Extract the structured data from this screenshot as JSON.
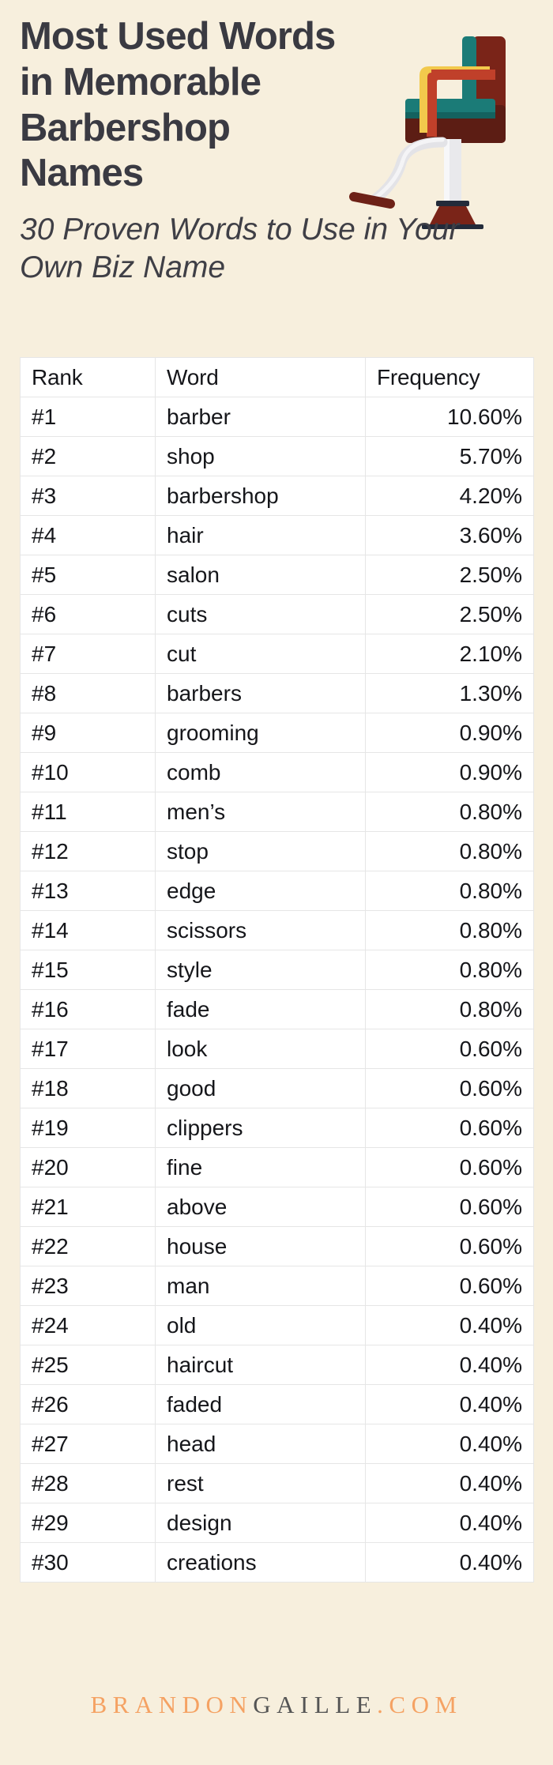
{
  "header": {
    "title": "Most Used Words in Memorable Barbershop Names",
    "title_lines": [
      "Most Used Words",
      "in Memorable",
      "Barbershop",
      "Names"
    ],
    "subtitle": "30 Proven Words to Use in Your Own Biz Name",
    "illustration": "barber-chair-icon"
  },
  "colors": {
    "background": "#f7efdd",
    "title_text": "#3a3a42",
    "table_background": "#ffffff",
    "table_border": "#e6e6e6",
    "table_text": "#15161a",
    "footer_accent": "#f5a263",
    "footer_dark": "#555555",
    "chair_upholstery_teal": "#1b7b77",
    "chair_frame_maroon": "#7a2418",
    "chair_highlight_red": "#c0402a",
    "chair_highlight_yellow": "#f2c94c",
    "chair_post_white": "#e9e9ec",
    "chair_base_dark": "#232b3a"
  },
  "table": {
    "columns": [
      "Rank",
      "Word",
      "Frequency"
    ],
    "rows": [
      {
        "rank": "#1",
        "word": "barber",
        "frequency": "10.60%"
      },
      {
        "rank": "#2",
        "word": "shop",
        "frequency": "5.70%"
      },
      {
        "rank": "#3",
        "word": "barbershop",
        "frequency": "4.20%"
      },
      {
        "rank": "#4",
        "word": "hair",
        "frequency": "3.60%"
      },
      {
        "rank": "#5",
        "word": "salon",
        "frequency": "2.50%"
      },
      {
        "rank": "#6",
        "word": "cuts",
        "frequency": "2.50%"
      },
      {
        "rank": "#7",
        "word": "cut",
        "frequency": "2.10%"
      },
      {
        "rank": "#8",
        "word": "barbers",
        "frequency": "1.30%"
      },
      {
        "rank": "#9",
        "word": "grooming",
        "frequency": "0.90%"
      },
      {
        "rank": "#10",
        "word": "comb",
        "frequency": "0.90%"
      },
      {
        "rank": "#11",
        "word": "men’s",
        "frequency": "0.80%"
      },
      {
        "rank": "#12",
        "word": "stop",
        "frequency": "0.80%"
      },
      {
        "rank": "#13",
        "word": "edge",
        "frequency": "0.80%"
      },
      {
        "rank": "#14",
        "word": "scissors",
        "frequency": "0.80%"
      },
      {
        "rank": "#15",
        "word": "style",
        "frequency": "0.80%"
      },
      {
        "rank": "#16",
        "word": "fade",
        "frequency": "0.80%"
      },
      {
        "rank": "#17",
        "word": "look",
        "frequency": "0.60%"
      },
      {
        "rank": "#18",
        "word": "good",
        "frequency": "0.60%"
      },
      {
        "rank": "#19",
        "word": "clippers",
        "frequency": "0.60%"
      },
      {
        "rank": "#20",
        "word": "fine",
        "frequency": "0.60%"
      },
      {
        "rank": "#21",
        "word": "above",
        "frequency": "0.60%"
      },
      {
        "rank": "#22",
        "word": "house",
        "frequency": "0.60%"
      },
      {
        "rank": "#23",
        "word": "man",
        "frequency": "0.60%"
      },
      {
        "rank": "#24",
        "word": "old",
        "frequency": "0.40%"
      },
      {
        "rank": "#25",
        "word": "haircut",
        "frequency": "0.40%"
      },
      {
        "rank": "#26",
        "word": "faded",
        "frequency": "0.40%"
      },
      {
        "rank": "#27",
        "word": "head",
        "frequency": "0.40%"
      },
      {
        "rank": "#28",
        "word": "rest",
        "frequency": "0.40%"
      },
      {
        "rank": "#29",
        "word": "design",
        "frequency": "0.40%"
      },
      {
        "rank": "#30",
        "word": "creations",
        "frequency": "0.40%"
      }
    ]
  },
  "footer": {
    "brand_accent_1": "BRANDON",
    "brand_dark": "GAILLE",
    "brand_accent_2": ".COM"
  },
  "chart_data": {
    "type": "table",
    "title": "Most Used Words in Memorable Barbershop Names",
    "subtitle": "30 Proven Words to Use in Your Own Biz Name",
    "xlabel": "Word",
    "ylabel": "Frequency",
    "categories": [
      "barber",
      "shop",
      "barbershop",
      "hair",
      "salon",
      "cuts",
      "cut",
      "barbers",
      "grooming",
      "comb",
      "men’s",
      "stop",
      "edge",
      "scissors",
      "style",
      "fade",
      "look",
      "good",
      "clippers",
      "fine",
      "above",
      "house",
      "man",
      "old",
      "haircut",
      "faded",
      "head",
      "rest",
      "design",
      "creations"
    ],
    "values": [
      10.6,
      5.7,
      4.2,
      3.6,
      2.5,
      2.5,
      2.1,
      1.3,
      0.9,
      0.9,
      0.8,
      0.8,
      0.8,
      0.8,
      0.8,
      0.8,
      0.6,
      0.6,
      0.6,
      0.6,
      0.6,
      0.6,
      0.6,
      0.4,
      0.4,
      0.4,
      0.4,
      0.4,
      0.4,
      0.4
    ],
    "ranks": [
      "#1",
      "#2",
      "#3",
      "#4",
      "#5",
      "#6",
      "#7",
      "#8",
      "#9",
      "#10",
      "#11",
      "#12",
      "#13",
      "#14",
      "#15",
      "#16",
      "#17",
      "#18",
      "#19",
      "#20",
      "#21",
      "#22",
      "#23",
      "#24",
      "#25",
      "#26",
      "#27",
      "#28",
      "#29",
      "#30"
    ],
    "unit": "%",
    "ylim": [
      0,
      10.6
    ],
    "grid": false,
    "legend": "none"
  }
}
